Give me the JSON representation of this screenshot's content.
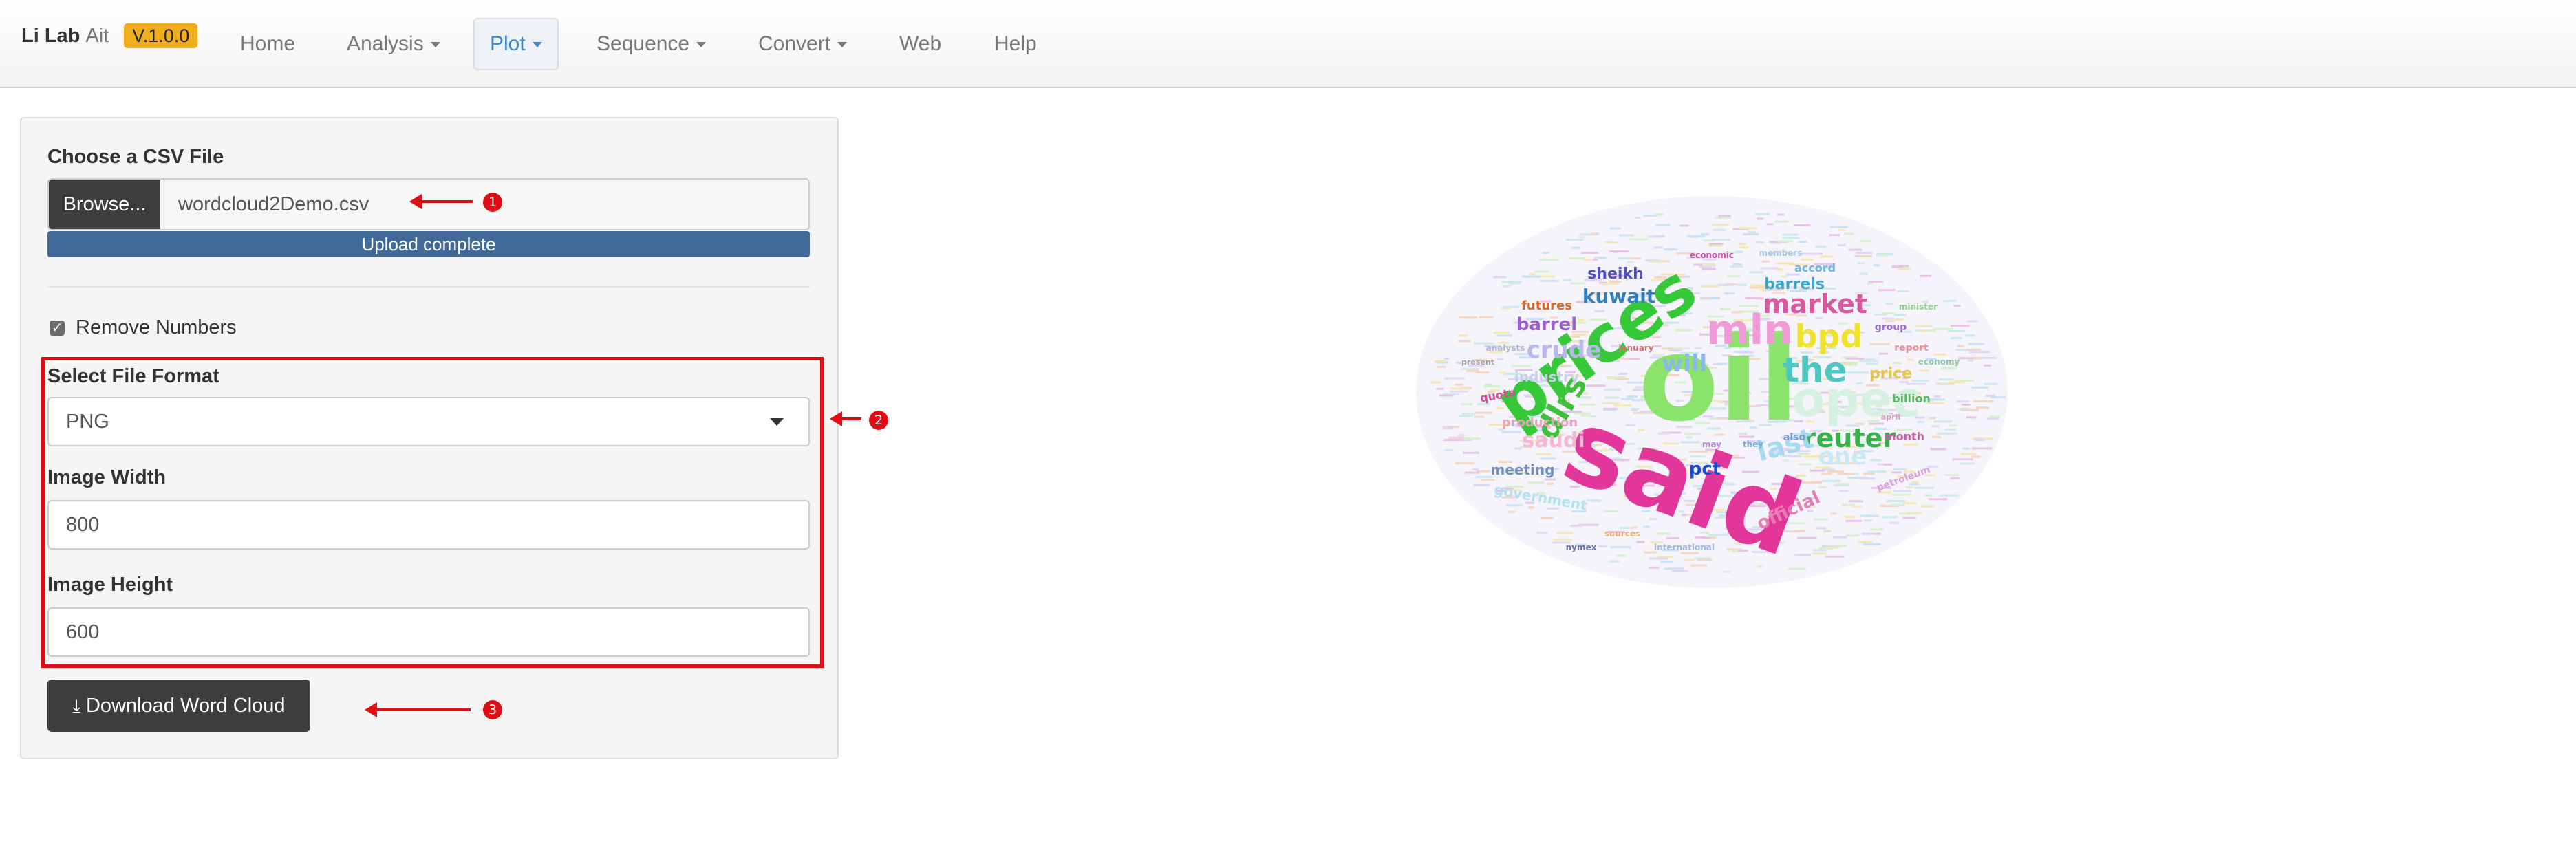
{
  "navbar": {
    "brand_bold": "Li Lab",
    "brand_light": "Ait",
    "version": "V.1.0.0",
    "items": [
      {
        "label": "Home",
        "has_caret": false
      },
      {
        "label": "Analysis",
        "has_caret": true
      },
      {
        "label": "Plot",
        "has_caret": true,
        "active": true
      },
      {
        "label": "Sequence",
        "has_caret": true
      },
      {
        "label": "Convert",
        "has_caret": true
      },
      {
        "label": "Web",
        "has_caret": false
      },
      {
        "label": "Help",
        "has_caret": false
      }
    ]
  },
  "panel": {
    "file_label": "Choose a CSV File",
    "browse_label": "Browse...",
    "file_name": "wordcloud2Demo.csv",
    "upload_status": "Upload complete",
    "remove_numbers_label": "Remove Numbers",
    "remove_numbers_checked": true,
    "format_label": "Select File Format",
    "format_value": "PNG",
    "width_label": "Image Width",
    "width_value": "800",
    "height_label": "Image Height",
    "height_value": "600",
    "download_label": "Download Word Cloud"
  },
  "annotations": {
    "marker_1": "1",
    "marker_2": "2",
    "marker_3": "3",
    "color": "#e00d15"
  },
  "wordcloud": {
    "words": [
      {
        "text": "oil",
        "color": "#8be36b"
      },
      {
        "text": "said",
        "color": "#e2369a"
      },
      {
        "text": "prices",
        "color": "#35c93a"
      },
      {
        "text": "opec",
        "color": "#d6f1e2"
      },
      {
        "text": "mln",
        "color": "#f19ad8"
      },
      {
        "text": "the",
        "color": "#4ec7c0"
      },
      {
        "text": "bpd",
        "color": "#f0e12c"
      },
      {
        "text": "market",
        "color": "#d75aa0"
      },
      {
        "text": "reuter",
        "color": "#38b24a"
      },
      {
        "text": "dlrs",
        "color": "#3fbf3a"
      },
      {
        "text": "crude",
        "color": "#b9b7ee"
      },
      {
        "text": "last",
        "color": "#a6d8f3"
      },
      {
        "text": "one",
        "color": "#c9eaf3"
      },
      {
        "text": "will",
        "color": "#8fb6e8"
      },
      {
        "text": "kuwait",
        "color": "#2f7fbf"
      },
      {
        "text": "barrel",
        "color": "#9b5fcf"
      },
      {
        "text": "barrels",
        "color": "#3aa7c9"
      },
      {
        "text": "saudi",
        "color": "#f4b6d2"
      },
      {
        "text": "official",
        "color": "#e87db5"
      },
      {
        "text": "pct",
        "color": "#1a4bd6"
      },
      {
        "text": "sheikh",
        "color": "#4f4fbf"
      },
      {
        "text": "futures",
        "color": "#d26b2b"
      },
      {
        "text": "industry",
        "color": "#c8d0e8"
      },
      {
        "text": "price",
        "color": "#e6c54a"
      },
      {
        "text": "billion",
        "color": "#57b86a"
      },
      {
        "text": "meeting",
        "color": "#6f8fc2"
      },
      {
        "text": "production",
        "color": "#e3a5b8"
      },
      {
        "text": "government",
        "color": "#b3e0f2"
      },
      {
        "text": "quota",
        "color": "#d04f9e"
      },
      {
        "text": "month",
        "color": "#c95fa8"
      },
      {
        "text": "accord",
        "color": "#6fb3e6"
      },
      {
        "text": "group",
        "color": "#9e6acb"
      },
      {
        "text": "report",
        "color": "#f18e9e"
      },
      {
        "text": "also",
        "color": "#7a9bc6"
      },
      {
        "text": "economic",
        "color": "#c74da5"
      },
      {
        "text": "members",
        "color": "#a8c8e8"
      },
      {
        "text": "petroleum",
        "color": "#d8a0e0"
      },
      {
        "text": "international",
        "color": "#a0b8e0"
      },
      {
        "text": "nymex",
        "color": "#6a6ab0"
      },
      {
        "text": "economy",
        "color": "#8fc7a8"
      },
      {
        "text": "analysts",
        "color": "#b2b2d8"
      },
      {
        "text": "january",
        "color": "#d97070"
      },
      {
        "text": "minister",
        "color": "#90d090"
      },
      {
        "text": "sources",
        "color": "#e4b070"
      },
      {
        "text": "may",
        "color": "#b48ad8"
      },
      {
        "text": "they",
        "color": "#7ab0d0"
      },
      {
        "text": "present",
        "color": "#a0a0a0"
      },
      {
        "text": "april",
        "color": "#d0a0c0"
      }
    ]
  }
}
